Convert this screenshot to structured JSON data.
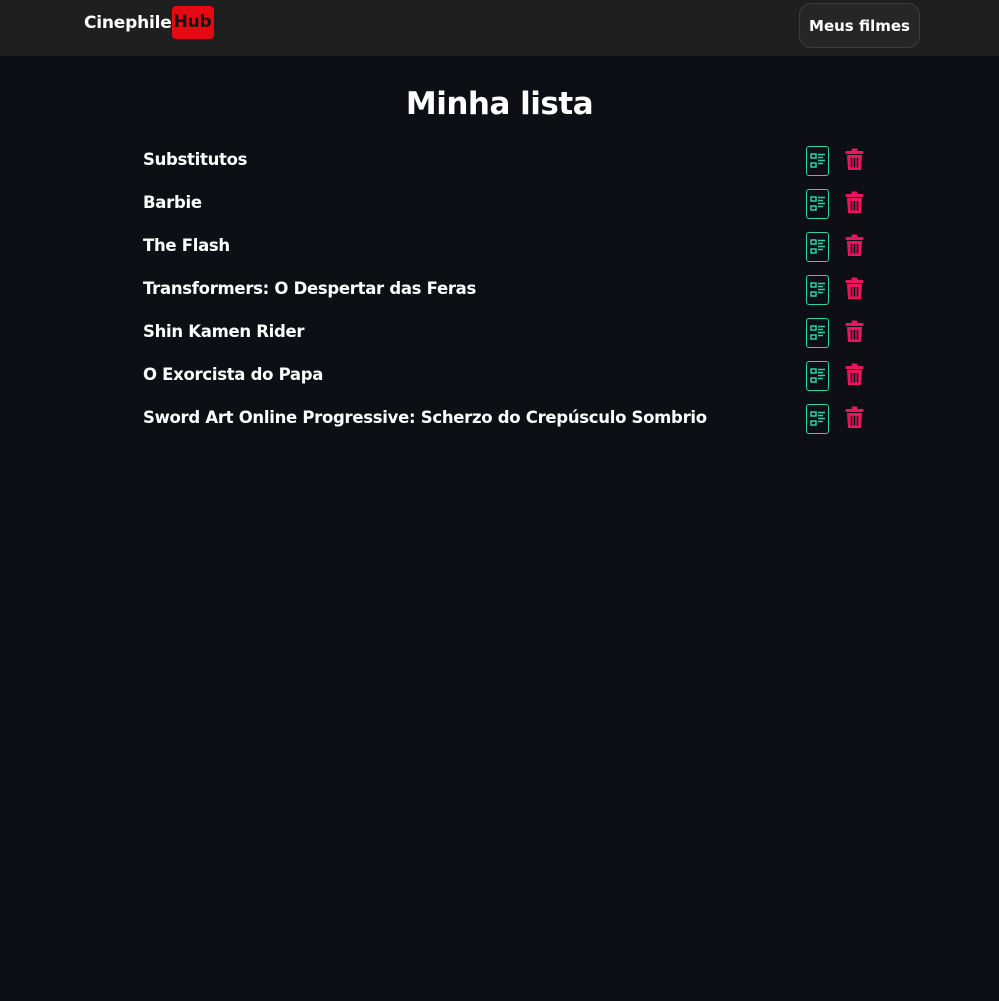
{
  "header": {
    "logo_primary": "Cinephile",
    "logo_accent": "Hub",
    "nav_button_label": "Meus filmes"
  },
  "page": {
    "title": "Minha lista"
  },
  "movies": [
    {
      "title": "Substitutos"
    },
    {
      "title": "Barbie"
    },
    {
      "title": "The Flash"
    },
    {
      "title": "Transformers: O Despertar das Feras"
    },
    {
      "title": "Shin Kamen Rider"
    },
    {
      "title": "O Exorcista do Papa"
    },
    {
      "title": "Sword Art Online Progressive: Scherzo do Crepúsculo Sombrio"
    }
  ],
  "icons": {
    "details": "details-list-icon",
    "delete": "trash-icon"
  },
  "colors": {
    "background": "#0d0f15",
    "header": "#1f1f1f",
    "brand_red": "#e50914",
    "details_green": "#2bd4a4",
    "delete_pink": "#e8175d"
  }
}
